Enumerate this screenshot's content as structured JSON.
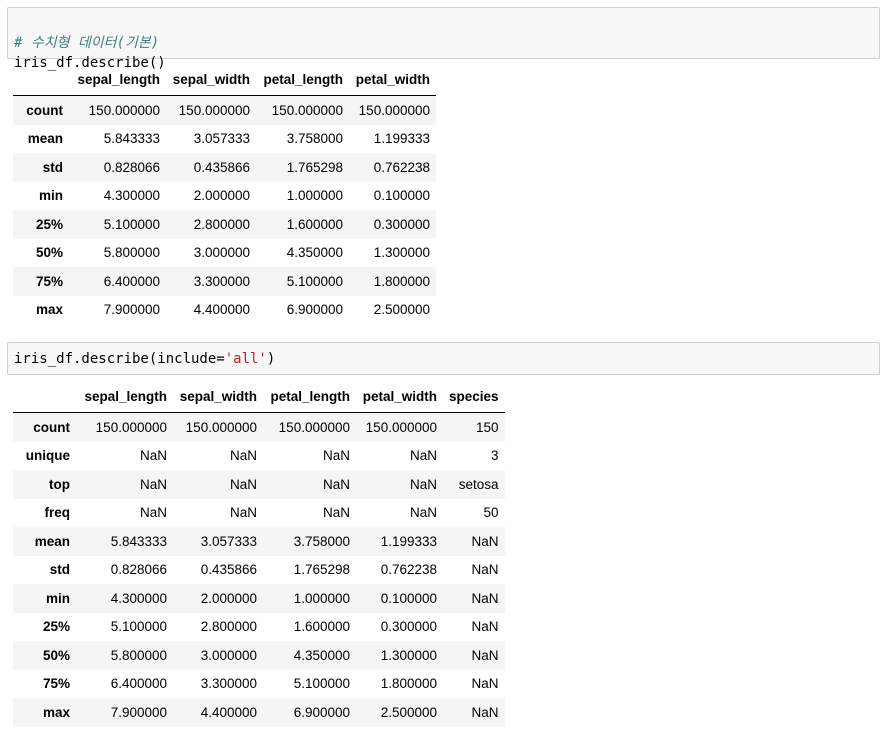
{
  "cell1": {
    "comment": "# 수치형 데이터(기본)",
    "code": "iris_df.describe()"
  },
  "table1": {
    "columns": [
      "sepal_length",
      "sepal_width",
      "petal_length",
      "petal_width"
    ],
    "rows": [
      {
        "label": "count",
        "values": [
          "150.000000",
          "150.000000",
          "150.000000",
          "150.000000"
        ]
      },
      {
        "label": "mean",
        "values": [
          "5.843333",
          "3.057333",
          "3.758000",
          "1.199333"
        ]
      },
      {
        "label": "std",
        "values": [
          "0.828066",
          "0.435866",
          "1.765298",
          "0.762238"
        ]
      },
      {
        "label": "min",
        "values": [
          "4.300000",
          "2.000000",
          "1.000000",
          "0.100000"
        ]
      },
      {
        "label": "25%",
        "values": [
          "5.100000",
          "2.800000",
          "1.600000",
          "0.300000"
        ]
      },
      {
        "label": "50%",
        "values": [
          "5.800000",
          "3.000000",
          "4.350000",
          "1.300000"
        ]
      },
      {
        "label": "75%",
        "values": [
          "6.400000",
          "3.300000",
          "5.100000",
          "1.800000"
        ]
      },
      {
        "label": "max",
        "values": [
          "7.900000",
          "4.400000",
          "6.900000",
          "2.500000"
        ]
      }
    ]
  },
  "cell2": {
    "code_prefix": "iris_df.describe(include=",
    "code_string": "'all'",
    "code_suffix": ")"
  },
  "table2": {
    "columns": [
      "sepal_length",
      "sepal_width",
      "petal_length",
      "petal_width",
      "species"
    ],
    "rows": [
      {
        "label": "count",
        "values": [
          "150.000000",
          "150.000000",
          "150.000000",
          "150.000000",
          "150"
        ]
      },
      {
        "label": "unique",
        "values": [
          "NaN",
          "NaN",
          "NaN",
          "NaN",
          "3"
        ]
      },
      {
        "label": "top",
        "values": [
          "NaN",
          "NaN",
          "NaN",
          "NaN",
          "setosa"
        ]
      },
      {
        "label": "freq",
        "values": [
          "NaN",
          "NaN",
          "NaN",
          "NaN",
          "50"
        ]
      },
      {
        "label": "mean",
        "values": [
          "5.843333",
          "3.057333",
          "3.758000",
          "1.199333",
          "NaN"
        ]
      },
      {
        "label": "std",
        "values": [
          "0.828066",
          "0.435866",
          "1.765298",
          "0.762238",
          "NaN"
        ]
      },
      {
        "label": "min",
        "values": [
          "4.300000",
          "2.000000",
          "1.000000",
          "0.100000",
          "NaN"
        ]
      },
      {
        "label": "25%",
        "values": [
          "5.100000",
          "2.800000",
          "1.600000",
          "0.300000",
          "NaN"
        ]
      },
      {
        "label": "50%",
        "values": [
          "5.800000",
          "3.000000",
          "4.350000",
          "1.300000",
          "NaN"
        ]
      },
      {
        "label": "75%",
        "values": [
          "6.400000",
          "3.300000",
          "5.100000",
          "1.800000",
          "NaN"
        ]
      },
      {
        "label": "max",
        "values": [
          "7.900000",
          "4.400000",
          "6.900000",
          "2.500000",
          "NaN"
        ]
      }
    ]
  },
  "colors": {
    "cell_background": "#f7f7f7",
    "cell_border": "#cfcfcf",
    "comment": "#408080",
    "string": "#ba2121",
    "row_stripe": "#f5f5f5"
  }
}
